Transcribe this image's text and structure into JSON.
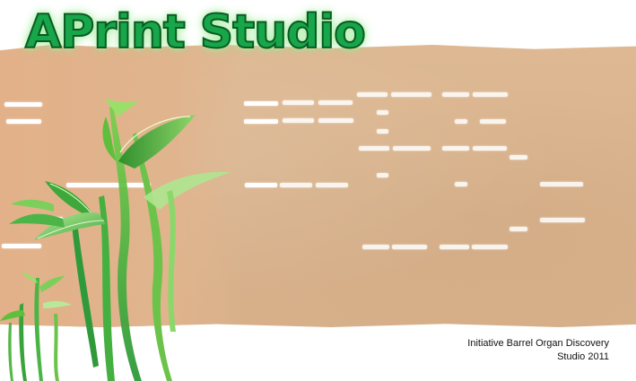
{
  "title": "APrint Studio",
  "caption": {
    "line1": "Initiative Barrel Organ Discovery",
    "line2": "Studio 2011"
  },
  "colors": {
    "paper": "#d9b48d",
    "title_fill": "#17a64a",
    "title_outline": "#0b5a22",
    "leaf_green": "#5cc24a"
  }
}
